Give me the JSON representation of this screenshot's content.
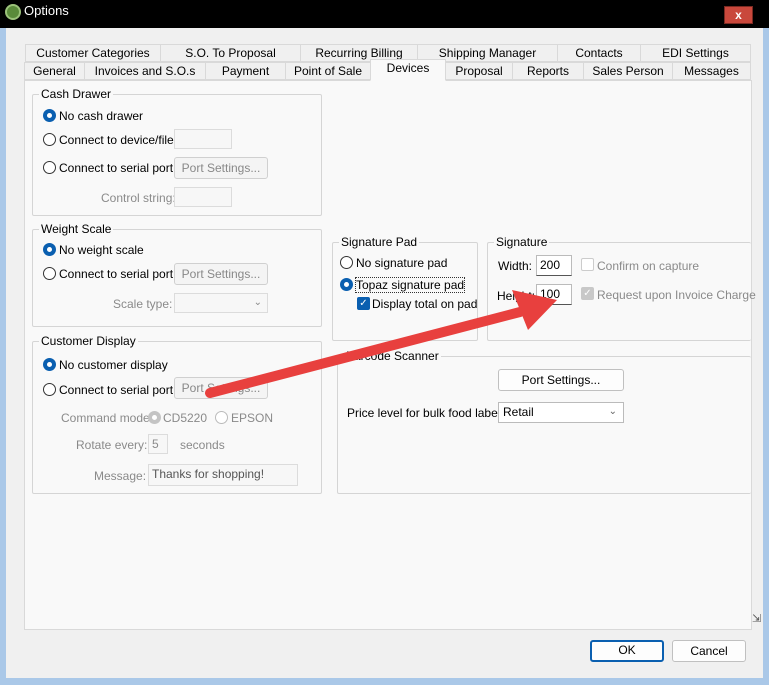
{
  "window": {
    "title": "Options",
    "close": "x"
  },
  "tabs": {
    "row1": [
      "Customer Categories",
      "S.O. To Proposal",
      "Recurring Billing",
      "Shipping Manager",
      "Contacts",
      "EDI Settings"
    ],
    "row2": [
      "General",
      "Invoices and S.O.s",
      "Payment",
      "Point of Sale",
      "Devices",
      "Proposal",
      "Reports",
      "Sales Person",
      "Messages"
    ],
    "selected": "Devices"
  },
  "cash_drawer": {
    "title": "Cash Drawer",
    "no_drawer": "No cash drawer",
    "device_file": "Connect to device/file:",
    "serial": "Connect to serial port:",
    "port_settings": "Port Settings...",
    "control_string": "Control string:"
  },
  "weight_scale": {
    "title": "Weight Scale",
    "none": "No weight scale",
    "serial": "Connect to serial port:",
    "port_settings": "Port Settings...",
    "scale_type": "Scale type:"
  },
  "customer_display": {
    "title": "Customer Display",
    "none": "No customer display",
    "serial": "Connect to serial port:",
    "port_settings": "Port Settings...",
    "command_mode": "Command mode:",
    "cd5220": "CD5220",
    "epson": "EPSON",
    "rotate": "Rotate every:",
    "rotate_value": "5",
    "seconds": "seconds",
    "message_label": "Message:",
    "message_value": "Thanks for shopping!"
  },
  "signature_pad": {
    "title": "Signature Pad",
    "none": "No signature pad",
    "topaz": "Topaz signature pad",
    "display_total": "Display total on pad"
  },
  "signature": {
    "title": "Signature",
    "width_label": "Width:",
    "width": "200",
    "height_label": "Height:",
    "height": "100",
    "confirm": "Confirm on capture",
    "request": "Request upon Invoice Charge"
  },
  "barcode": {
    "title": "Barcode Scanner",
    "port_settings": "Port Settings...",
    "price_level_label": "Price level for bulk food label:",
    "price_level": "Retail"
  },
  "footer": {
    "ok": "OK",
    "cancel": "Cancel"
  },
  "annotation_color": "#e8403e"
}
